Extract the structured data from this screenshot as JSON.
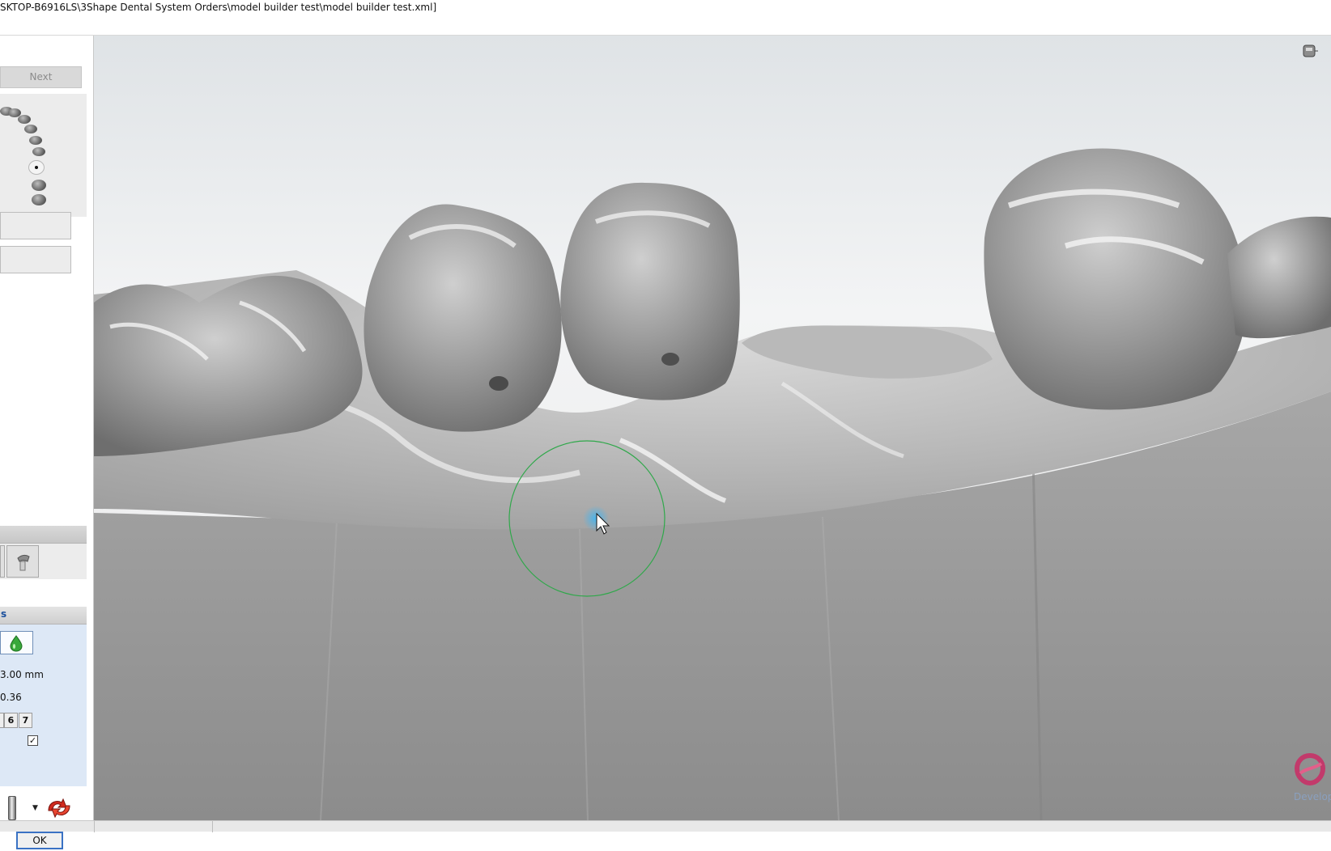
{
  "window": {
    "title": "SKTOP-B6916LS\\3Shape Dental System Orders\\model builder test\\model builder test.xml]"
  },
  "left_panel": {
    "next_label": "Next",
    "wax_section_label": "s",
    "diameter_value": "3.00 mm",
    "strength_value": "0.36",
    "number_buttons": [
      "6",
      "7"
    ],
    "checkbox_checked": true,
    "ok_label": "OK"
  },
  "viewport": {
    "logo_text": "Develop",
    "brush_color": "#2fa84a",
    "cursor_highlight_color": "#3ea6e0"
  }
}
